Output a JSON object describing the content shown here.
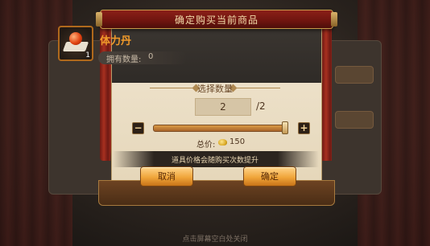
{
  "dialog": {
    "title": "确定购买当前商品"
  },
  "item": {
    "name": "体力丹",
    "icon": "red-orb-on-pedestal",
    "stack_count": "1",
    "owned_label": "拥有数量:",
    "owned_value": "0"
  },
  "quantity": {
    "title": "选择数量",
    "current": "2",
    "max": "/2",
    "minus_symbol": "−",
    "plus_symbol": "+",
    "slider_fraction": 1.0
  },
  "price": {
    "label": "总价:",
    "currency_icon": "gold-ingot-icon",
    "value": "150"
  },
  "notice": "道具价格会随购买次数提升",
  "buttons": {
    "cancel": "取消",
    "confirm": "确定"
  },
  "hint": "点击屏幕空白处关闭",
  "colors": {
    "accent": "#f19a2a",
    "button": "#f0a53a",
    "banner": "#8b1f18"
  }
}
